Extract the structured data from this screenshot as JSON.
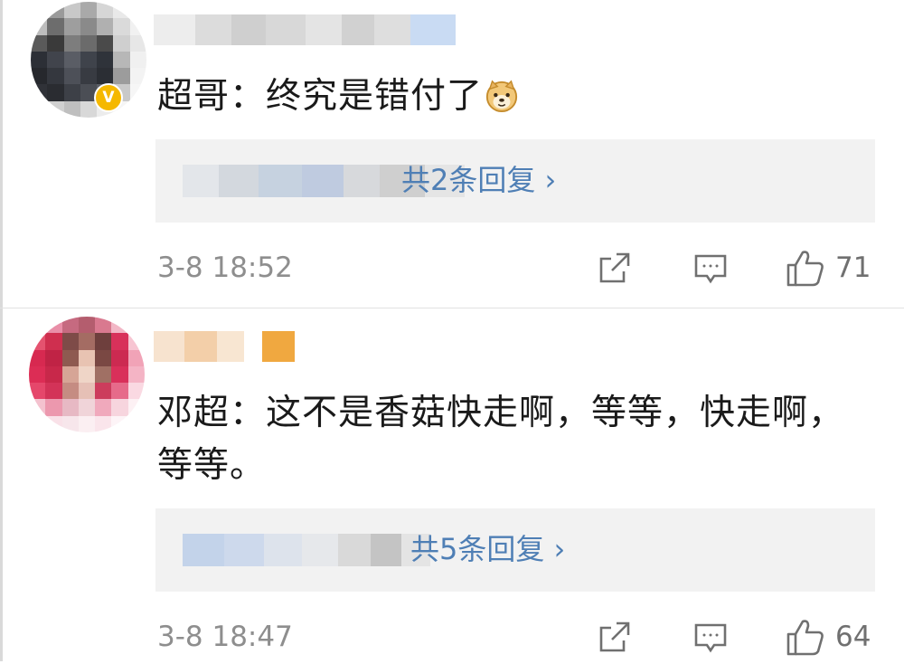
{
  "comments": [
    {
      "author_text": "超哥",
      "separator": "：",
      "content": "终究是错付了",
      "emoji": "doge-emoji",
      "reply_link": "共2条回复 ›",
      "timestamp": "3-8 18:52",
      "likes": "71"
    },
    {
      "author_text": "邓超",
      "separator": "：",
      "content": "这不是香菇快走啊，等等，快走啊，等等。",
      "reply_link": "共5条回复 ›",
      "timestamp": "3-8 18:47",
      "likes": "64"
    }
  ],
  "icons": {
    "share": "share-icon",
    "reply": "comment-icon",
    "like": "thumbs-up-icon"
  },
  "colors": {
    "link": "#4f7fb5",
    "meta": "#8e8e8e",
    "reply_bg": "#f2f2f2"
  }
}
